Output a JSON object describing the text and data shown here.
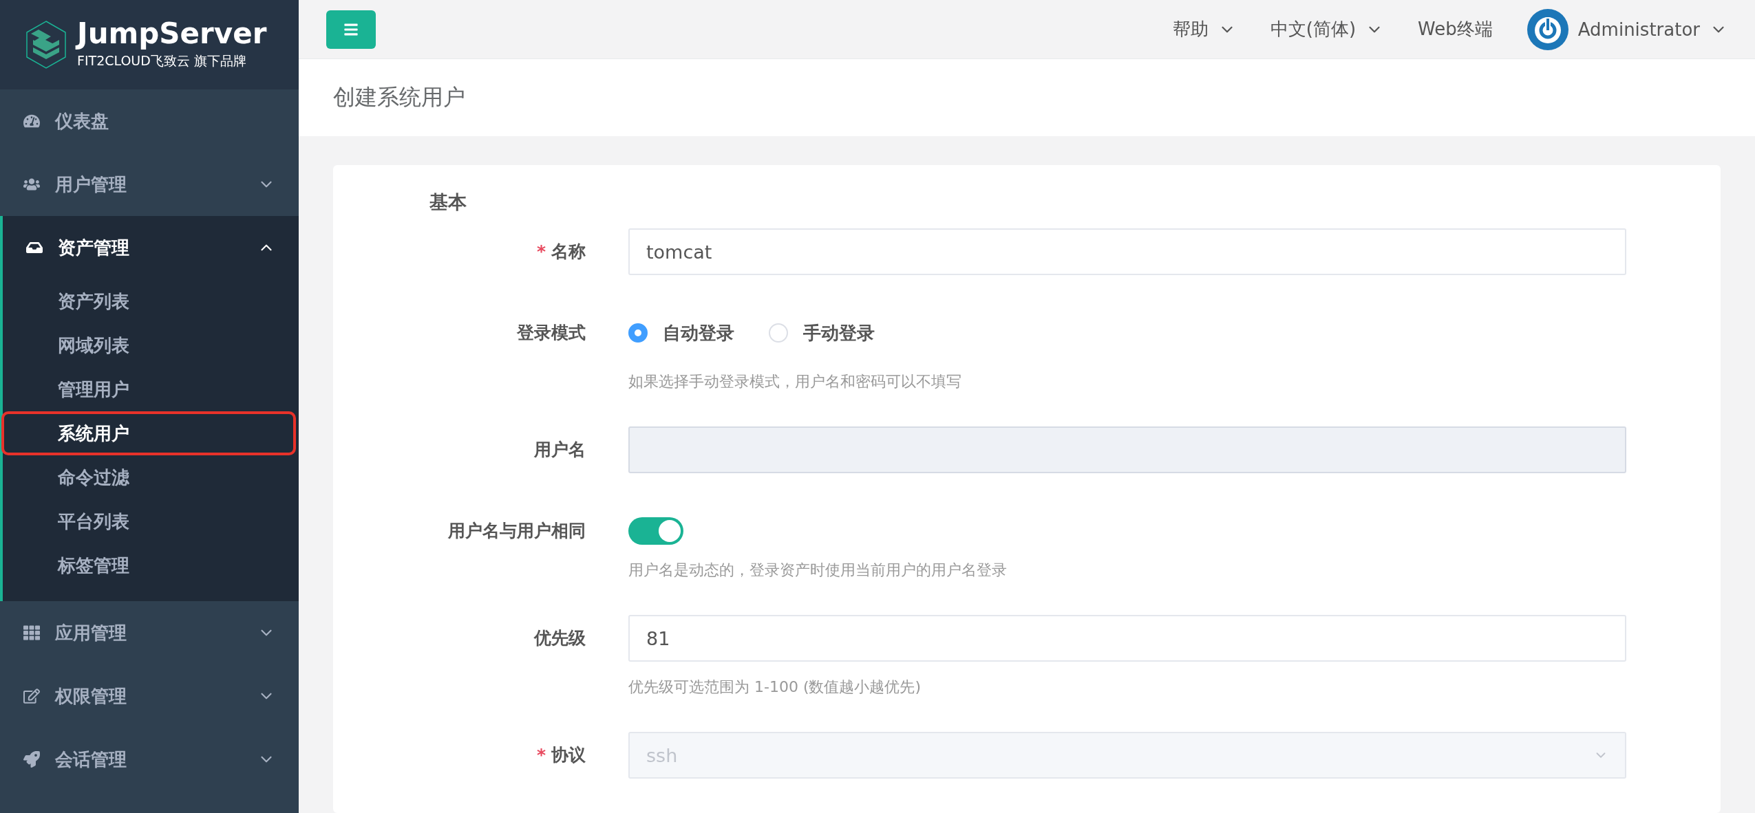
{
  "logo": {
    "name": "JumpServer",
    "tagline": "FIT2CLOUD飞致云 旗下品牌"
  },
  "sidebar": {
    "items": [
      {
        "label": "仪表盘",
        "kind": "link"
      },
      {
        "label": "用户管理",
        "kind": "group",
        "expanded": false
      },
      {
        "label": "资产管理",
        "kind": "group",
        "expanded": true,
        "children": [
          {
            "label": "资产列表",
            "selected": false
          },
          {
            "label": "网域列表",
            "selected": false
          },
          {
            "label": "管理用户",
            "selected": false
          },
          {
            "label": "系统用户",
            "selected": true
          },
          {
            "label": "命令过滤",
            "selected": false
          },
          {
            "label": "平台列表",
            "selected": false
          },
          {
            "label": "标签管理",
            "selected": false
          }
        ]
      },
      {
        "label": "应用管理",
        "kind": "group",
        "expanded": false
      },
      {
        "label": "权限管理",
        "kind": "group",
        "expanded": false
      },
      {
        "label": "会话管理",
        "kind": "group",
        "expanded": false
      }
    ]
  },
  "header": {
    "nav": [
      {
        "label": "帮助",
        "kind": "dropdown"
      },
      {
        "label": "中文(简体)",
        "kind": "dropdown"
      },
      {
        "label": "Web终端",
        "kind": "link"
      }
    ],
    "user": {
      "name": "Administrator"
    }
  },
  "page_title": "创建系统用户",
  "form": {
    "section": "基本",
    "fields": [
      {
        "label": "名称",
        "kind": "text",
        "marker": "*",
        "value": "tomcat",
        "disabled": false
      },
      {
        "label": "登录模式",
        "kind": "radio",
        "options": [
          {
            "label": "自动登录",
            "selected": true
          },
          {
            "label": "手动登录",
            "selected": false
          }
        ],
        "hint": "如果选择手动登录模式，用户名和密码可以不填写"
      },
      {
        "label": "用户名",
        "kind": "text",
        "disabled": true
      },
      {
        "label": "用户名与用户相同",
        "kind": "switch",
        "on": true,
        "hint": "用户名是动态的，登录资产时使用当前用户的用户名登录"
      },
      {
        "label": "优先级",
        "kind": "text",
        "value": "81",
        "disabled": false,
        "hint": "优先级可选范围为 1-100 (数值越小越优先)"
      },
      {
        "label": "协议",
        "kind": "select",
        "marker": "*",
        "value": "ssh",
        "disabled": true
      }
    ]
  }
}
